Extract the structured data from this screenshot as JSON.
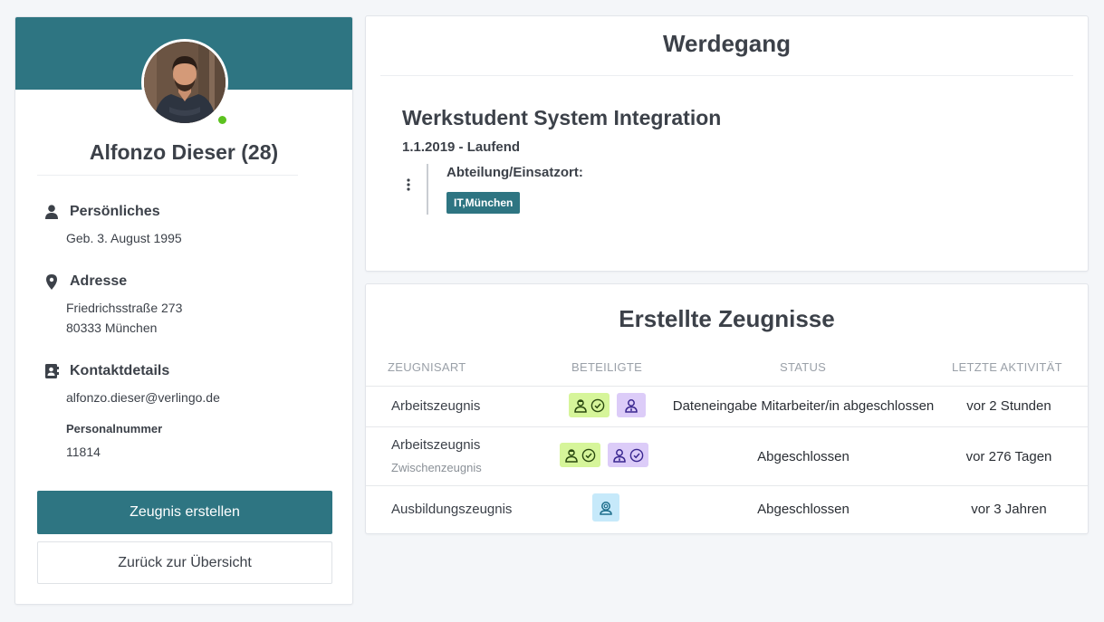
{
  "profile": {
    "name": "Alfonzo Dieser (28)",
    "sections": {
      "personal": {
        "title": "Persönliches",
        "birth": "Geb. 3. August 1995"
      },
      "address": {
        "title": "Adresse",
        "street": "Friedrichsstraße 273",
        "city": "80333 München"
      },
      "contact": {
        "title": "Kontaktdetails",
        "email": "alfonzo.dieser@verlingo.de",
        "personnel_label": "Personalnummer",
        "personnel_number": "11814"
      }
    },
    "buttons": {
      "create": "Zeugnis erstellen",
      "back": "Zurück zur Übersicht"
    },
    "status_color": "#5cc21f"
  },
  "career": {
    "title": "Werdegang",
    "job": {
      "title": "Werkstudent System Integration",
      "period": "1.1.2019 - Laufend",
      "department_label": "Abteilung/Einsatzort:",
      "department_tag": "IT,München"
    }
  },
  "certificates": {
    "title": "Erstellte Zeugnisse",
    "columns": [
      "ZEUGNISART",
      "BETEILIGTE",
      "STATUS",
      "LETZTE AKTIVITÄT"
    ],
    "rows": [
      {
        "type": "Arbeitszeugnis",
        "subtype": "",
        "status": "Dateneingabe Mitarbeiter/in abgeschlossen",
        "activity": "vor 2 Stunden",
        "participants": [
          "employee-done",
          "manager"
        ]
      },
      {
        "type": "Arbeitszeugnis",
        "subtype": "Zwischenzeugnis",
        "status": "Abgeschlossen",
        "activity": "vor 276 Tagen",
        "participants": [
          "employee-done",
          "manager-done"
        ]
      },
      {
        "type": "Ausbildungszeugnis",
        "subtype": "",
        "status": "Abgeschlossen",
        "activity": "vor 3 Jahren",
        "participants": [
          "trainee"
        ]
      }
    ]
  },
  "colors": {
    "brand": "#2e7582",
    "employee_badge": "#d6f59a",
    "manager_badge": "#dcccf8",
    "trainee_badge": "#c6e9fa",
    "background": "#f4f6f9"
  }
}
